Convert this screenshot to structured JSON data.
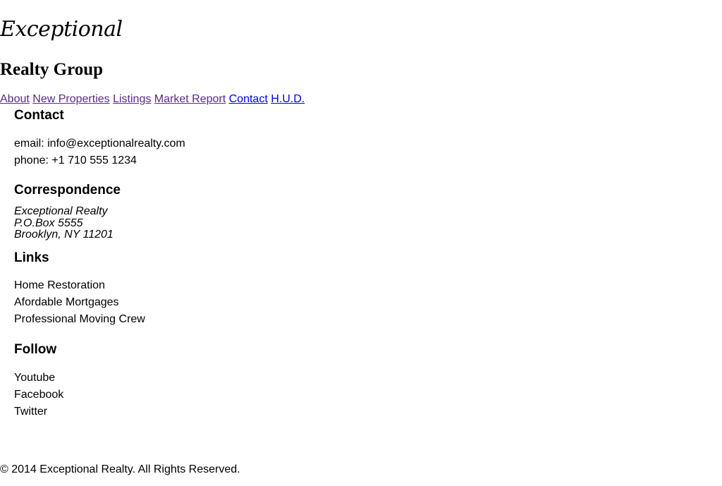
{
  "brand": {
    "line1": "Exceptional",
    "line2": "Realty Group"
  },
  "nav": {
    "items": [
      "About",
      "New Properties",
      "Listings",
      "Market Report",
      "Contact",
      "H.U.D."
    ]
  },
  "contact": {
    "heading": "Contact",
    "email": "email: info@exceptionalrealty.com",
    "phone": "phone: +1 710 555 1234"
  },
  "correspondence": {
    "heading": "Correspondence",
    "lines": [
      "Exceptional Realty",
      "P.O.Box 5555",
      "Brooklyn, NY 11201"
    ]
  },
  "links": {
    "heading": "Links",
    "items": [
      "Home Restoration",
      "Afordable Mortgages",
      "Professional Moving Crew"
    ]
  },
  "follow": {
    "heading": "Follow",
    "items": [
      "Youtube",
      "Facebook",
      "Twitter"
    ]
  },
  "footer": {
    "copyright": "© 2014 Exceptional Realty. All Rights Reserved."
  },
  "colors": {
    "visited_link": "#5b2a86",
    "unvisited_link": "#0000ee",
    "text": "#000000",
    "background": "#ffffff"
  }
}
